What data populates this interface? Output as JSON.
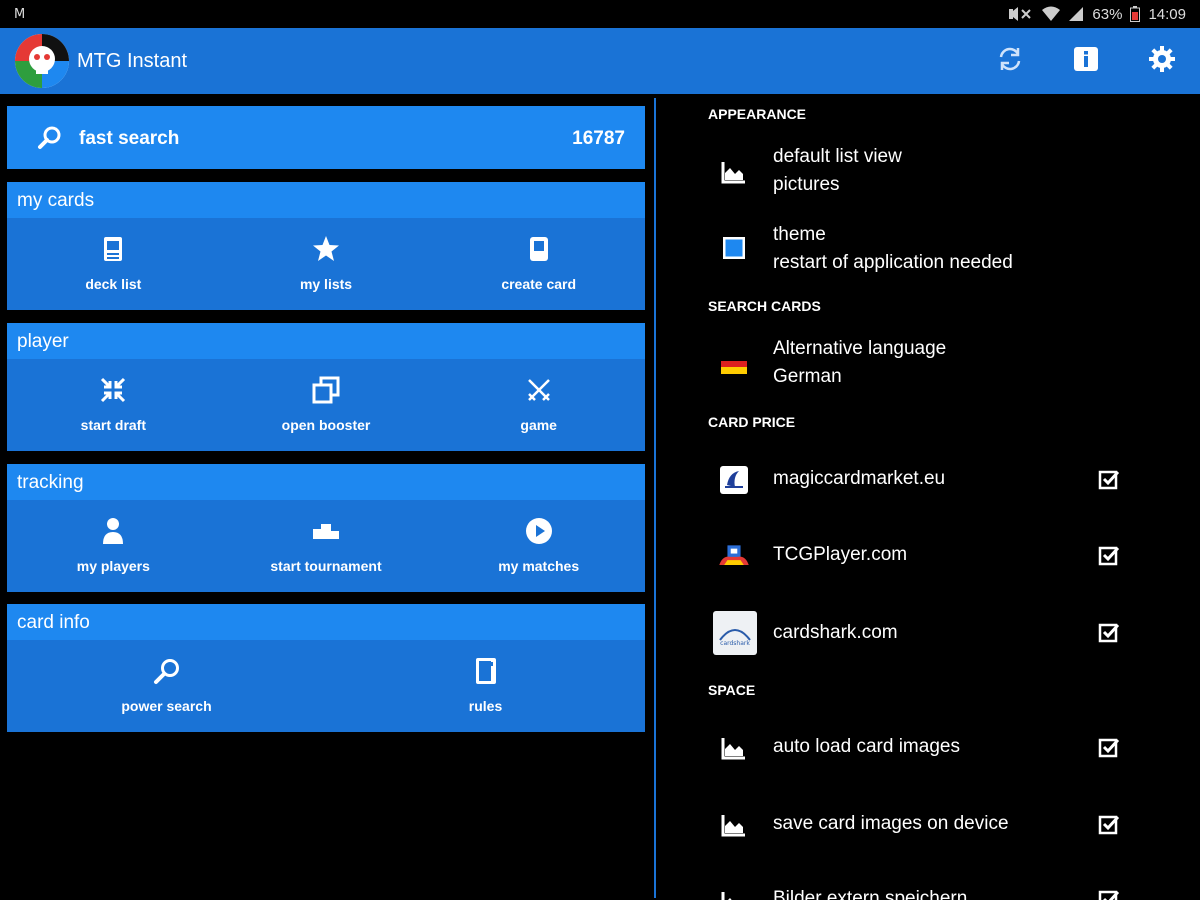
{
  "status": {
    "left_glyph": "M",
    "battery": "63%",
    "time": "14:09"
  },
  "appbar": {
    "title": "MTG Instant",
    "actions": [
      "refresh-icon",
      "info-icon",
      "settings-icon"
    ]
  },
  "search": {
    "label": "fast search",
    "count": "16787"
  },
  "sections": [
    {
      "title": "my cards",
      "tiles": [
        {
          "label": "deck list",
          "icon": "deck-list-icon"
        },
        {
          "label": "my lists",
          "icon": "star-icon"
        },
        {
          "label": "create card",
          "icon": "card-icon"
        }
      ]
    },
    {
      "title": "player",
      "tiles": [
        {
          "label": "start draft",
          "icon": "collapse-arrows-icon"
        },
        {
          "label": "open booster",
          "icon": "booster-icon"
        },
        {
          "label": "game",
          "icon": "swords-icon"
        }
      ]
    },
    {
      "title": "tracking",
      "tiles": [
        {
          "label": "my players",
          "icon": "person-icon"
        },
        {
          "label": "start tournament",
          "icon": "podium-icon"
        },
        {
          "label": "my matches",
          "icon": "play-circle-icon"
        }
      ]
    },
    {
      "title": "card info",
      "tiles": [
        {
          "label": "power search",
          "icon": "search-icon"
        },
        {
          "label": "rules",
          "icon": "book-icon"
        }
      ]
    }
  ],
  "settings": {
    "appearance": {
      "header": "APPEARANCE",
      "list_view": {
        "title": "default list view",
        "value": "pictures",
        "icon": "image-icon"
      },
      "theme": {
        "title": "theme",
        "value": "restart of application needed",
        "icon": "color-square-icon",
        "color": "#1e88f0"
      }
    },
    "search_cards": {
      "header": "SEARCH CARDS",
      "language": {
        "title": "Alternative language",
        "value": "German",
        "icon": "german-flag-icon"
      }
    },
    "card_price": {
      "header": "CARD PRICE",
      "items": [
        {
          "title": "magiccardmarket.eu",
          "icon": "magiccardmarket-logo-icon",
          "checked": true
        },
        {
          "title": "TCGPlayer.com",
          "icon": "tcgplayer-logo-icon",
          "checked": true
        },
        {
          "title": "cardshark.com",
          "icon": "cardshark-logo-icon",
          "logo_text": "cardshark",
          "checked": true
        }
      ]
    },
    "space": {
      "header": "SPACE",
      "items": [
        {
          "title": "auto load card images",
          "icon": "image-icon",
          "checked": true
        },
        {
          "title": "save card images on device",
          "icon": "image-icon",
          "checked": true
        },
        {
          "title": "Bilder extern speichern",
          "icon": "image-icon",
          "checked": true
        }
      ]
    }
  },
  "colors": {
    "primary": "#1a73d6",
    "primary_light": "#1e88f0",
    "background": "#000000"
  }
}
